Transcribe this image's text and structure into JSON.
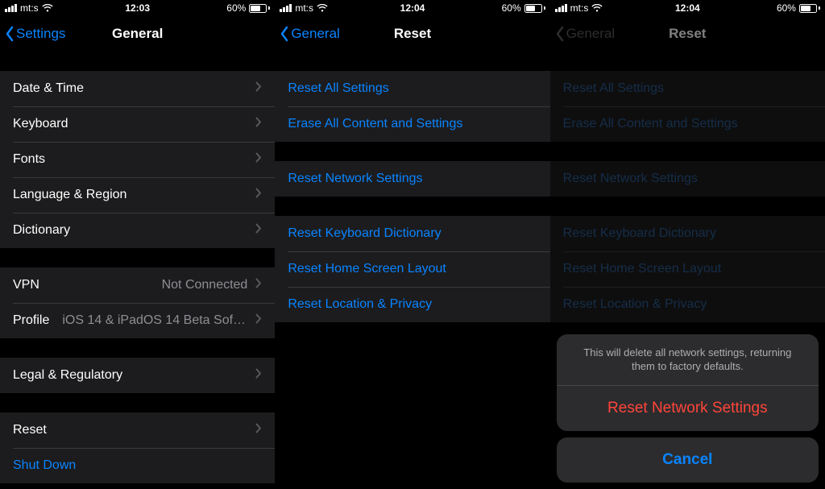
{
  "status": {
    "carrier": "mt:s",
    "time1": "12:03",
    "time2": "12:04",
    "time3": "12:04",
    "batteryText": "60%"
  },
  "screen1": {
    "back": "Settings",
    "title": "General",
    "groups": {
      "g1": [
        {
          "label": "Date & Time"
        },
        {
          "label": "Keyboard"
        },
        {
          "label": "Fonts"
        },
        {
          "label": "Language & Region"
        },
        {
          "label": "Dictionary"
        }
      ],
      "g2": [
        {
          "label": "VPN",
          "detail": "Not Connected"
        },
        {
          "label": "Profile",
          "detail": "iOS 14 & iPadOS 14 Beta Softwar..."
        }
      ],
      "g3": [
        {
          "label": "Legal & Regulatory"
        }
      ],
      "g4": [
        {
          "label": "Reset"
        },
        {
          "label": "Shut Down",
          "link": true
        }
      ]
    }
  },
  "screen2": {
    "back": "General",
    "title": "Reset",
    "groups": {
      "g1": [
        "Reset All Settings",
        "Erase All Content and Settings"
      ],
      "g2": [
        "Reset Network Settings"
      ],
      "g3": [
        "Reset Keyboard Dictionary",
        "Reset Home Screen Layout",
        "Reset Location & Privacy"
      ]
    }
  },
  "screen3": {
    "back": "General",
    "title": "Reset",
    "sheet": {
      "message": "This will delete all network settings, returning them to factory defaults.",
      "destructive": "Reset Network Settings",
      "cancel": "Cancel"
    }
  }
}
